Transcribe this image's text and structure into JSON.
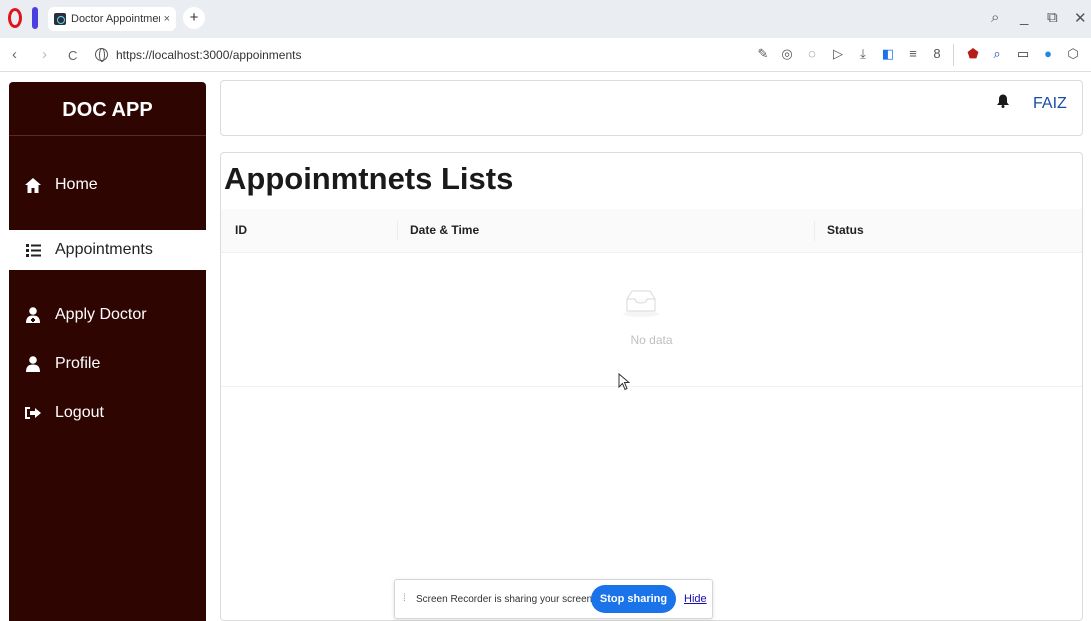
{
  "browser": {
    "tab_title": "Doctor Appointment S",
    "tab_close": "×",
    "new_tab": "+",
    "url": "https://localhost:3000/appoinments",
    "nav": {
      "back": "‹",
      "forward": "›",
      "reload": "C"
    },
    "window_controls": {
      "search": "⌕",
      "minimize": "_",
      "restore": "⧉",
      "close": "✕"
    },
    "toolbar_icons": [
      "edit-icon",
      "camera-icon",
      "pocket-icon",
      "send-icon",
      "download-icon",
      "sidebar-toggle-icon",
      "menu-icon",
      "profile-icon",
      "ublock-icon",
      "lookup-icon",
      "tab-icon",
      "extension-blue-icon",
      "cube-icon"
    ]
  },
  "sidebar": {
    "brand": "DOC APP",
    "items": [
      {
        "label": "Home",
        "icon": "home-icon",
        "active": false
      },
      {
        "label": "Appointments",
        "icon": "list-icon",
        "active": true
      },
      {
        "label": "Apply Doctor",
        "icon": "user-doctor-icon",
        "active": false
      },
      {
        "label": "Profile",
        "icon": "user-icon",
        "active": false
      },
      {
        "label": "Logout",
        "icon": "logout-icon",
        "active": false
      }
    ]
  },
  "header": {
    "user_name": "FAIZ",
    "bell_icon": "bell-icon"
  },
  "main": {
    "title": "Appoinmtnets Lists",
    "columns": [
      "ID",
      "Date & Time",
      "Status"
    ],
    "rows": [],
    "empty_text": "No data"
  },
  "screen_share": {
    "message": "Screen Recorder is sharing your screen.",
    "stop_label": "Stop sharing",
    "hide_label": "Hide"
  },
  "colors": {
    "sidebar_bg": "#2e0501",
    "accent_blue": "#1a73e8",
    "user_name": "#1a4ca8"
  }
}
